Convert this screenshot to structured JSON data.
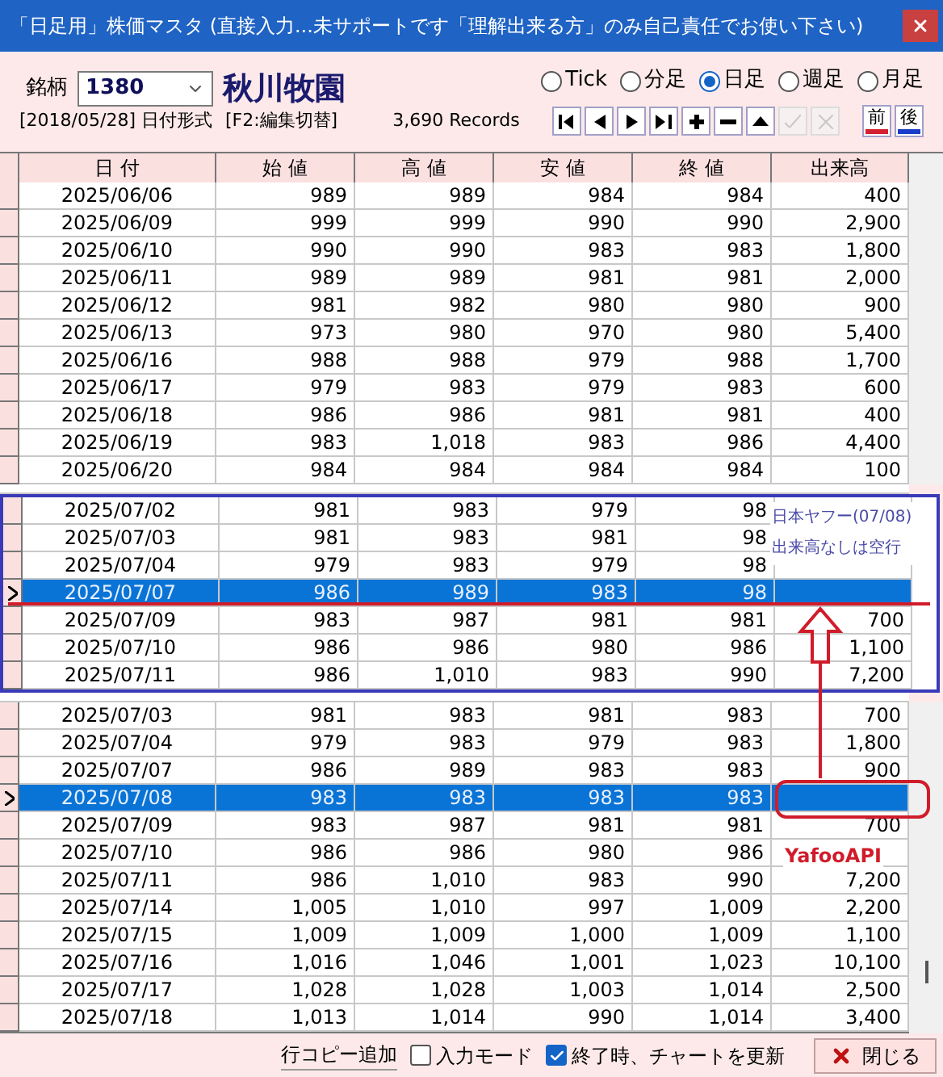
{
  "window": {
    "title": "「日足用」株価マスタ (直接入力...未サポートです「理解出来る方」のみ自己責任でお使い下さい)"
  },
  "symbol": {
    "label": "銘柄",
    "code": "1380",
    "name": "秋川牧園"
  },
  "intervals": [
    {
      "label": "Tick",
      "selected": false
    },
    {
      "label": "分足",
      "selected": false
    },
    {
      "label": "日足",
      "selected": true
    },
    {
      "label": "週足",
      "selected": false
    },
    {
      "label": "月足",
      "selected": false
    }
  ],
  "info": {
    "date_format": "[2018/05/28] 日付形式",
    "edit_toggle": "[F2:編集切替]",
    "records": "3,690 Records"
  },
  "toolbar": [
    {
      "kind": "first",
      "disabled": false
    },
    {
      "kind": "prev",
      "disabled": false
    },
    {
      "kind": "next",
      "disabled": false
    },
    {
      "kind": "last",
      "disabled": false
    },
    {
      "kind": "add",
      "disabled": false
    },
    {
      "kind": "remove",
      "disabled": false
    },
    {
      "kind": "up",
      "disabled": false
    },
    {
      "kind": "post",
      "disabled": true
    },
    {
      "kind": "cancel",
      "disabled": true
    }
  ],
  "period_buttons": [
    {
      "label": "前",
      "color": "#d42030"
    },
    {
      "label": "後",
      "color": "#1a3cc8"
    }
  ],
  "table": {
    "columns": [
      "日 付",
      "始 値",
      "高 値",
      "安 値",
      "終 値",
      "出来高"
    ],
    "rows_top": [
      {
        "cells": [
          "2025/06/06",
          "989",
          "989",
          "984",
          "984",
          "400"
        ],
        "selected": false
      },
      {
        "cells": [
          "2025/06/09",
          "999",
          "999",
          "990",
          "990",
          "2,900"
        ],
        "selected": false
      },
      {
        "cells": [
          "2025/06/10",
          "990",
          "990",
          "983",
          "983",
          "1,800"
        ],
        "selected": false
      },
      {
        "cells": [
          "2025/06/11",
          "989",
          "989",
          "981",
          "981",
          "2,000"
        ],
        "selected": false
      },
      {
        "cells": [
          "2025/06/12",
          "981",
          "982",
          "980",
          "980",
          "900"
        ],
        "selected": false
      },
      {
        "cells": [
          "2025/06/13",
          "973",
          "980",
          "970",
          "980",
          "5,400"
        ],
        "selected": false
      },
      {
        "cells": [
          "2025/06/16",
          "988",
          "988",
          "979",
          "988",
          "1,700"
        ],
        "selected": false
      },
      {
        "cells": [
          "2025/06/17",
          "979",
          "983",
          "979",
          "983",
          "600"
        ],
        "selected": false
      },
      {
        "cells": [
          "2025/06/18",
          "986",
          "986",
          "981",
          "981",
          "400"
        ],
        "selected": false
      },
      {
        "cells": [
          "2025/06/19",
          "983",
          "1,018",
          "983",
          "986",
          "4,400"
        ],
        "selected": false
      },
      {
        "cells": [
          "2025/06/20",
          "984",
          "984",
          "984",
          "984",
          "100"
        ],
        "selected": false
      }
    ],
    "rows_bottom": [
      {
        "cells": [
          "2025/07/03",
          "981",
          "983",
          "981",
          "983",
          "700"
        ],
        "selected": false
      },
      {
        "cells": [
          "2025/07/04",
          "979",
          "983",
          "979",
          "983",
          "1,800"
        ],
        "selected": false
      },
      {
        "cells": [
          "2025/07/07",
          "986",
          "989",
          "983",
          "983",
          "900"
        ],
        "selected": false
      },
      {
        "cells": [
          "2025/07/08",
          "983",
          "983",
          "983",
          "983"
        ],
        "selected": true
      },
      {
        "cells": [
          "2025/07/09",
          "983",
          "987",
          "981",
          "981",
          "700"
        ],
        "selected": false
      },
      {
        "cells": [
          "2025/07/10",
          "986",
          "986",
          "980",
          "986"
        ],
        "selected": false
      },
      {
        "cells": [
          "2025/07/11",
          "986",
          "1,010",
          "983",
          "990",
          "7,200"
        ],
        "selected": false
      },
      {
        "cells": [
          "2025/07/14",
          "1,005",
          "1,010",
          "997",
          "1,009",
          "2,200"
        ],
        "selected": false
      },
      {
        "cells": [
          "2025/07/15",
          "1,009",
          "1,009",
          "1,000",
          "1,009",
          "1,100"
        ],
        "selected": false
      },
      {
        "cells": [
          "2025/07/16",
          "1,016",
          "1,046",
          "1,001",
          "1,023",
          "10,100"
        ],
        "selected": false
      },
      {
        "cells": [
          "2025/07/17",
          "1,028",
          "1,028",
          "1,003",
          "1,014",
          "2,500"
        ],
        "selected": false
      },
      {
        "cells": [
          "2025/07/18",
          "1,013",
          "1,014",
          "990",
          "1,014",
          "3,400"
        ],
        "selected": false
      }
    ]
  },
  "inset": {
    "rows": [
      {
        "cells": [
          "2025/07/02",
          "981",
          "983",
          "979",
          "98"
        ],
        "selected": false
      },
      {
        "cells": [
          "2025/07/03",
          "981",
          "983",
          "981",
          "98"
        ],
        "selected": false
      },
      {
        "cells": [
          "2025/07/04",
          "979",
          "983",
          "979",
          "98"
        ],
        "selected": false
      },
      {
        "cells": [
          "2025/07/07",
          "986",
          "989",
          "983",
          "98"
        ],
        "selected": true
      },
      {
        "cells": [
          "2025/07/09",
          "983",
          "987",
          "981",
          "981",
          "700"
        ],
        "selected": false
      },
      {
        "cells": [
          "2025/07/10",
          "986",
          "986",
          "980",
          "986",
          "1,100"
        ],
        "selected": false
      },
      {
        "cells": [
          "2025/07/11",
          "986",
          "1,010",
          "983",
          "990",
          "7,200"
        ],
        "selected": false
      }
    ],
    "note": [
      "日本ヤフー(07/08)",
      "出来高なしは空行"
    ]
  },
  "callout": {
    "label": "YafooAPI"
  },
  "footer": {
    "copy_label": "行コピー追加",
    "options": [
      {
        "label": "入力モード",
        "checked": false
      },
      {
        "label": "終了時、チャートを更新",
        "checked": true
      }
    ],
    "close_button": "閉じる"
  }
}
